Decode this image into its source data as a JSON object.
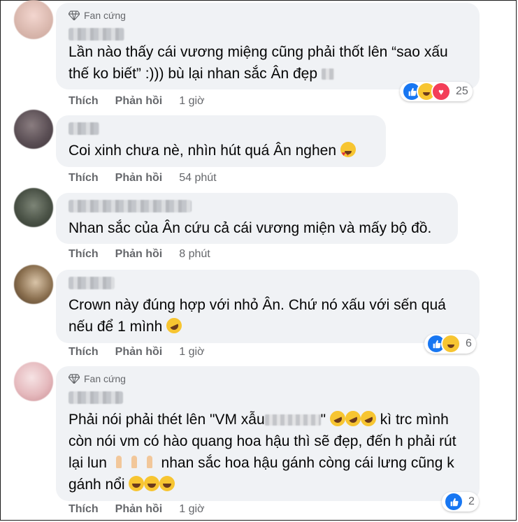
{
  "labels": {
    "like": "Thích",
    "reply": "Phản hồi",
    "fan_badge": "Fan cứng"
  },
  "comments": [
    {
      "fan": true,
      "text_parts": [
        "Lần nào thấy cái vương miệng cũng phải thốt lên “sao xấu thế ko biết” :))) bù lại nhan sắc Ân đẹp "
      ],
      "time": "1 giờ",
      "reactions": [
        "like",
        "haha",
        "love"
      ],
      "reaction_count": "25"
    },
    {
      "fan": false,
      "text_parts": [
        "Coi xinh chưa nè, nhìn hút quá Ân nghen "
      ],
      "time": "54 phút",
      "reactions": [],
      "reaction_count": ""
    },
    {
      "fan": false,
      "text_parts": [
        "Nhan sắc của Ân cứu cả cái vương miện và mấy bộ đồ."
      ],
      "time": "8 phút",
      "reactions": [],
      "reaction_count": ""
    },
    {
      "fan": false,
      "text_parts": [
        "Crown này đúng hợp với nhỏ Ân. Chứ nó xấu với sến quá nếu để 1 mình "
      ],
      "time": "1 giờ",
      "reactions": [
        "like",
        "haha"
      ],
      "reaction_count": "6"
    },
    {
      "fan": true,
      "text_parts": [
        "Phải nói phải thét lên \"VM xẫu",
        "\" ",
        " kì trc mình còn nói vm có hào quang hoa hậu thì sẽ đẹp, đến h phải rút lại lun ",
        " nhan sắc hoa hậu gánh còng cái lưng cũng k gánh nổi "
      ],
      "time": "1 giờ",
      "reactions": [
        "like"
      ],
      "reaction_count": "2"
    }
  ],
  "colors": {
    "bubble": "#f0f2f5",
    "meta_text": "#65676b",
    "like_blue": "#1877f2",
    "haha_yellow": "#f7c531",
    "love_red": "#f33e58"
  }
}
